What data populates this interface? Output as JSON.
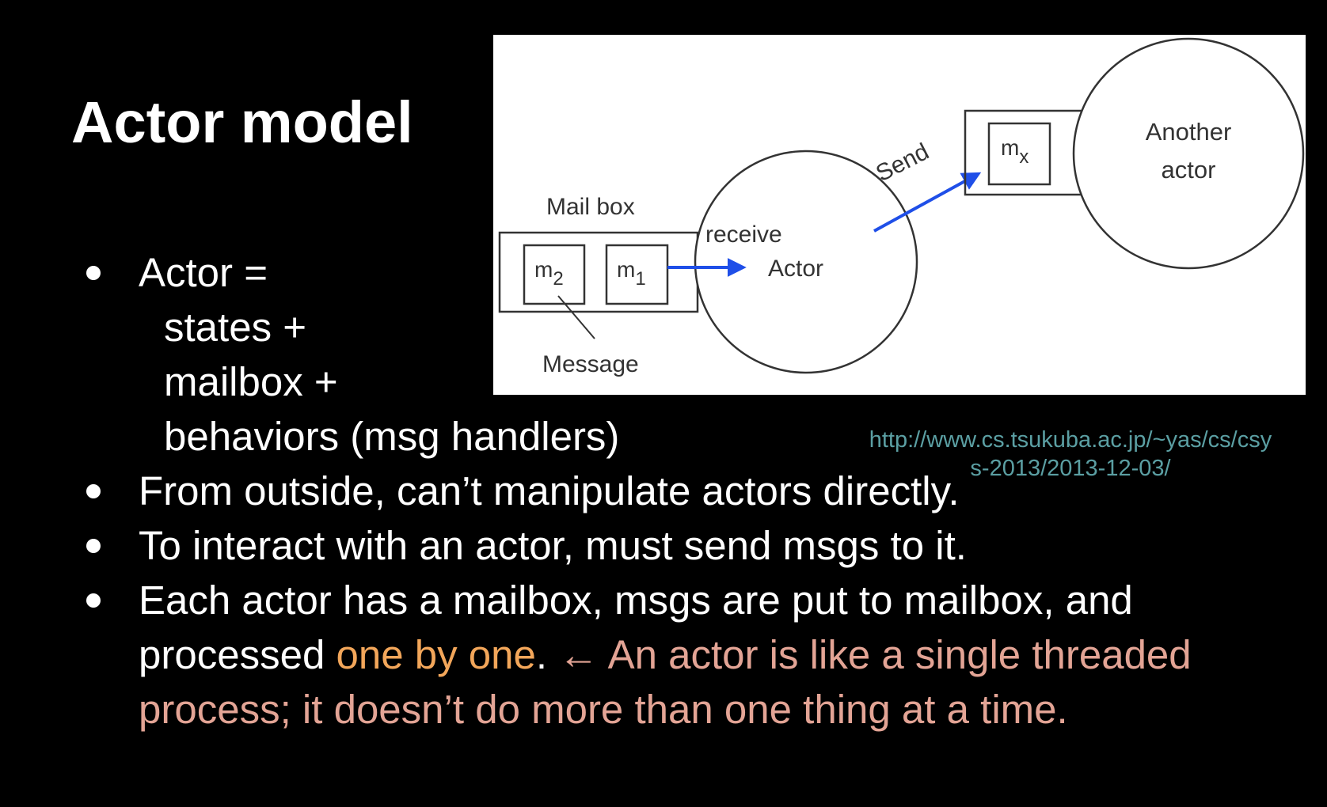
{
  "slide": {
    "title": "Actor model"
  },
  "diagram": {
    "mailbox_label": "Mail box",
    "message_m2": "m",
    "message_m2_sub": "2",
    "message_m1": "m",
    "message_m1_sub": "1",
    "message_label": "Message",
    "receive_label": "receive",
    "actor_label": "Actor",
    "send_label": "Send",
    "message_mx": "m",
    "message_mx_sub": "x",
    "another_actor_line1": "Another",
    "another_actor_line2": "actor",
    "arrow_color": "#1f4fe8",
    "line_color": "#333333"
  },
  "source": {
    "url": "http://www.cs.tsukuba.ac.jp/~yas/cs/csys-2013/2013-12-03/"
  },
  "bullets": {
    "b1_line1": "Actor =",
    "b1_line2": "states +",
    "b1_line3": "mailbox +",
    "b1_line4": "behaviors (msg handlers)",
    "b2": "From outside, can’t manipulate actors directly.",
    "b3": "To interact with an actor, must send msgs to it.",
    "b4_part1": "Each actor has a mailbox, msgs are put to mailbox, and processed ",
    "b4_highlight": "one by one",
    "b4_part2": ". ",
    "b4_note": "← An actor is like a single threaded process; it doesn’t do more than one thing at a time.",
    "highlight_color": "#f2a65a",
    "note_color": "#e3a495"
  }
}
